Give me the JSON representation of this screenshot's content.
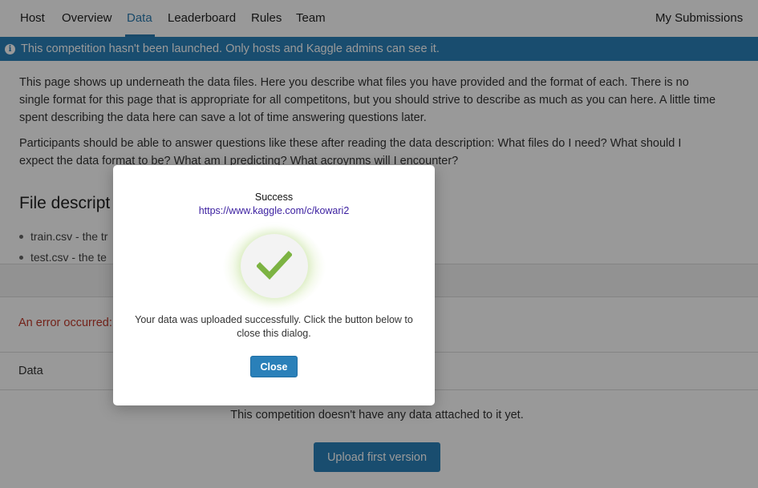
{
  "nav": {
    "items": [
      {
        "label": "Host",
        "active": false
      },
      {
        "label": "Overview",
        "active": false
      },
      {
        "label": "Data",
        "active": true
      },
      {
        "label": "Leaderboard",
        "active": false
      },
      {
        "label": "Rules",
        "active": false
      },
      {
        "label": "Team",
        "active": false
      }
    ],
    "right_label": "My Submissions"
  },
  "banner": {
    "icon": "info-icon",
    "text": "This competition hasn't been launched. Only hosts and Kaggle admins can see it."
  },
  "description": {
    "para1": "This page shows up underneath the data files. Here you describe what files you have provided and the format of each. There is no single format for this page that is appropriate for all competitons, but you should strive to describe as much as you can here. A little time spent describing the data here can save a lot of time answering questions later.",
    "para2": "Participants should be able to answer questions like these after reading the data description: What files do I need? What should I expect the data format to be? What am I predicting? What acroynms will I encounter?"
  },
  "files": {
    "heading": "File descript",
    "items": [
      "train.csv - the tr",
      "test.csv - the te"
    ]
  },
  "error_text": "An error occurred:",
  "data_section": {
    "label": "Data",
    "empty_text": "This competition doesn't have any data attached to it yet.",
    "upload_button": "Upload first version"
  },
  "modal": {
    "title": "Success",
    "link": "https://www.kaggle.com/c/kowari2",
    "icon": "checkmark-icon",
    "message": "Your data was uploaded successfully. Click the button below to close this dialog.",
    "close_button": "Close"
  },
  "colors": {
    "accent": "#2a80b9",
    "error": "#c0392b",
    "check": "#7cb342"
  }
}
